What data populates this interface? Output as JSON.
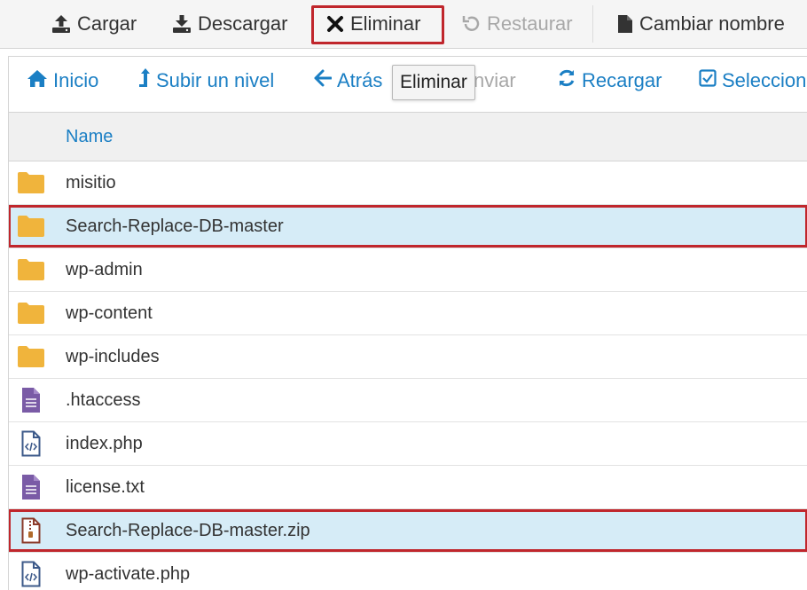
{
  "toolbar": {
    "buttons": [
      {
        "label": "Cargar",
        "icon": "upload-icon",
        "enabled": true
      },
      {
        "label": "Descargar",
        "icon": "download-icon",
        "enabled": true
      },
      {
        "label": "Eliminar",
        "icon": "close-icon",
        "enabled": true,
        "highlighted": true
      },
      {
        "label": "Restaurar",
        "icon": "restore-icon",
        "enabled": false
      },
      {
        "label": "Cambiar nombre",
        "icon": "file-icon",
        "enabled": true
      }
    ]
  },
  "navbar": {
    "buttons": [
      {
        "label": "Inicio",
        "icon": "home-icon",
        "enabled": true
      },
      {
        "label": "Subir un nivel",
        "icon": "level-up-icon",
        "enabled": true
      },
      {
        "label": "Atrás",
        "icon": "arrow-left-icon",
        "enabled": true
      },
      {
        "label": "nviar",
        "icon": "",
        "enabled": false
      },
      {
        "label": "Recargar",
        "icon": "refresh-icon",
        "enabled": true
      },
      {
        "label": "Seleccionar",
        "icon": "checkbox-icon",
        "enabled": true
      }
    ]
  },
  "tooltip": {
    "text": "Eliminar"
  },
  "table": {
    "column_name": "Name",
    "rows": [
      {
        "name": "misitio",
        "type": "folder",
        "selected": false,
        "highlighted": false
      },
      {
        "name": "Search-Replace-DB-master",
        "type": "folder",
        "selected": true,
        "highlighted": true
      },
      {
        "name": "wp-admin",
        "type": "folder",
        "selected": false,
        "highlighted": false
      },
      {
        "name": "wp-content",
        "type": "folder",
        "selected": false,
        "highlighted": false
      },
      {
        "name": "wp-includes",
        "type": "folder",
        "selected": false,
        "highlighted": false
      },
      {
        "name": ".htaccess",
        "type": "text",
        "selected": false,
        "highlighted": false
      },
      {
        "name": "index.php",
        "type": "code",
        "selected": false,
        "highlighted": false
      },
      {
        "name": "license.txt",
        "type": "text",
        "selected": false,
        "highlighted": false
      },
      {
        "name": "Search-Replace-DB-master.zip",
        "type": "zip",
        "selected": true,
        "highlighted": true
      },
      {
        "name": "wp-activate.php",
        "type": "code",
        "selected": false,
        "highlighted": false
      }
    ]
  },
  "colors": {
    "accent": "#1b7fc4",
    "highlight_border": "#c0262c",
    "selected_row": "#d6ecf7",
    "folder": "#f0b43c",
    "text_file": "#7a5ba6",
    "code_file": "#3d5a8a",
    "zip_file": "#8b3a2a"
  }
}
